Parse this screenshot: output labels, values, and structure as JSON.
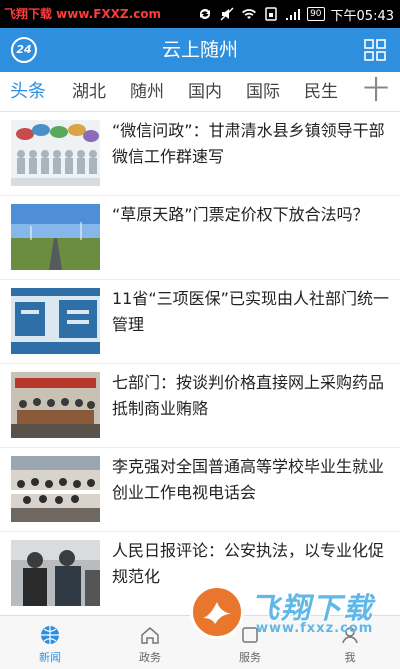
{
  "status_bar": {
    "watermark_text": "飞翔下载 www.FXXZ.com",
    "battery": "90",
    "time": "下午05:43"
  },
  "header": {
    "badge": "24",
    "title": "云上随州",
    "grid_icon": "grid-icon"
  },
  "tabs": [
    {
      "label": "头条",
      "active": true
    },
    {
      "label": "湖北"
    },
    {
      "label": "随州"
    },
    {
      "label": "国内"
    },
    {
      "label": "国际"
    },
    {
      "label": "民生"
    }
  ],
  "tab_plus": "十",
  "news": [
    {
      "title": "“微信问政”：甘肃清水县乡镇领导干部微信工作群速写",
      "thumb": "people-chat-bubbles"
    },
    {
      "title": "“草原天路”门票定价权下放合法吗？",
      "thumb": "road-landscape"
    },
    {
      "title": "11省“三项医保”已实现由人社部门统一管理",
      "thumb": "medical-insurance-text"
    },
    {
      "title": "七部门：按谈判价格直接网上采购药品 抵制商业贿赂",
      "thumb": "meeting-room"
    },
    {
      "title": "李克强对全国普通高等学校毕业生就业创业工作电视电话会",
      "thumb": "conference-hall"
    },
    {
      "title": "人民日报评论：公安执法，以专业化促规范化",
      "thumb": "police-officers"
    }
  ],
  "bottom_nav": [
    {
      "label": "新闻",
      "icon": "globe-icon",
      "active": true
    },
    {
      "label": "政务",
      "icon": "home-icon"
    },
    {
      "label": "服务",
      "icon": "service-icon"
    },
    {
      "label": "我",
      "icon": "user-icon"
    }
  ],
  "watermark": {
    "title": "飞翔下载",
    "url": "www.fxxz.com"
  },
  "colors": {
    "brand_blue": "#2f8fdf",
    "status_bar": "#000000",
    "watermark_orange": "#e8762c"
  }
}
